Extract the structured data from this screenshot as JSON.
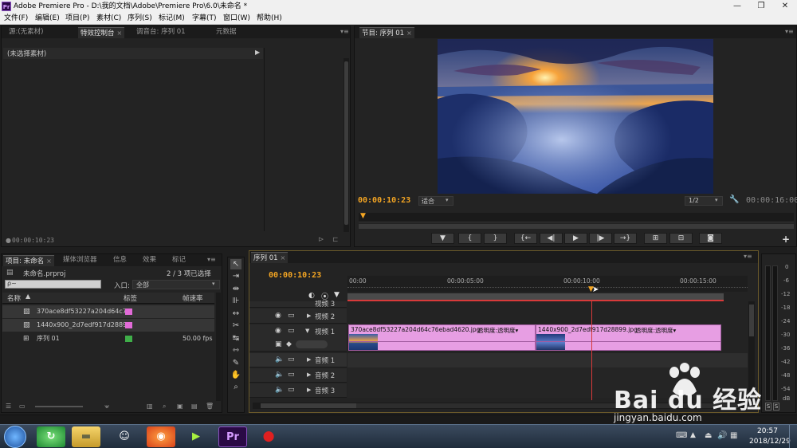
{
  "window": {
    "app_icon": "Pr",
    "title": "Adobe Premiere Pro - D:\\我的文档\\Adobe\\Premiere Pro\\6.0\\未命名 *",
    "minimize": "—",
    "maximize": "❐",
    "close": "✕"
  },
  "menu": [
    "文件(F)",
    "编辑(E)",
    "项目(P)",
    "素材(C)",
    "序列(S)",
    "标记(M)",
    "字幕(T)",
    "窗口(W)",
    "帮助(H)"
  ],
  "source_panel": {
    "tabs": [
      "源:(无素材)",
      "特效控制台",
      "调音台: 序列 01",
      "元数据"
    ],
    "active_tab": 1,
    "no_clip_label": "(未选择素材)",
    "timecode": "00:00:10:23"
  },
  "program_monitor": {
    "tab": "节目: 序列 01",
    "current_time": "00:00:10:23",
    "fit": "适合",
    "resolution": "1/2",
    "duration": "00:00:16:00",
    "controls": [
      "▼",
      "{",
      "}",
      "{←",
      "◀|",
      "▶",
      "|▶",
      "→}",
      "⊞",
      "⊟",
      "◙"
    ],
    "add_button": "+"
  },
  "project_panel": {
    "tabs": [
      "项目: 未命名",
      "媒体浏览器",
      "信息",
      "效果",
      "标记"
    ],
    "active_tab": 0,
    "project_file": "未命名.prproj",
    "selection_info": "2 / 3 项已选择",
    "search_placeholder": "ρ~",
    "in_label": "入口:",
    "in_value": "全部",
    "columns": [
      "名称",
      "标签",
      "帧速率"
    ],
    "items": [
      {
        "name": "370ace8df53227a204d64c7",
        "color": "#e26bd8",
        "fps": ""
      },
      {
        "name": "1440x900_2d7edf917d28899",
        "color": "#e26bd8",
        "fps": ""
      },
      {
        "name": "序列 01",
        "color": "#3fae49",
        "fps": "50.00 fps"
      }
    ]
  },
  "timeline": {
    "tab": "序列 01",
    "current_time": "00:00:10:23",
    "ruler": [
      "00:00",
      "00:00:05:00",
      "00:00:10:00",
      "00:00:15:00"
    ],
    "video_tracks": [
      {
        "name": "视频 3"
      },
      {
        "name": "视频 2"
      },
      {
        "name": "视频 1"
      }
    ],
    "audio_tracks": [
      {
        "name": "音频 1"
      },
      {
        "name": "音频 2"
      },
      {
        "name": "音频 3"
      }
    ],
    "clips": [
      {
        "name": "370ace8df53227a204d64c76ebad4620.jpg",
        "effect": "透明度:透明度▾"
      },
      {
        "name": "1440x900_2d7edf917d28899.jpg",
        "effect": "透明度:透明度▾"
      }
    ]
  },
  "audio_meter": {
    "scale": [
      "0",
      "-6",
      "-12",
      "-18",
      "-24",
      "-30",
      "-36",
      "-42",
      "-48",
      "-54",
      "dB"
    ],
    "solo": [
      "S",
      "S"
    ]
  },
  "taskbar": {
    "time": "20:57",
    "date": "2018/12/29"
  },
  "watermark": {
    "brand": "Bai du 经验",
    "url": "jingyan.baidu.com"
  },
  "colors": {
    "accent_orange": "#f5a623",
    "clip_pink": "#e79ee3",
    "playhead_red": "#d83a3a",
    "panel_bg": "#232323"
  }
}
